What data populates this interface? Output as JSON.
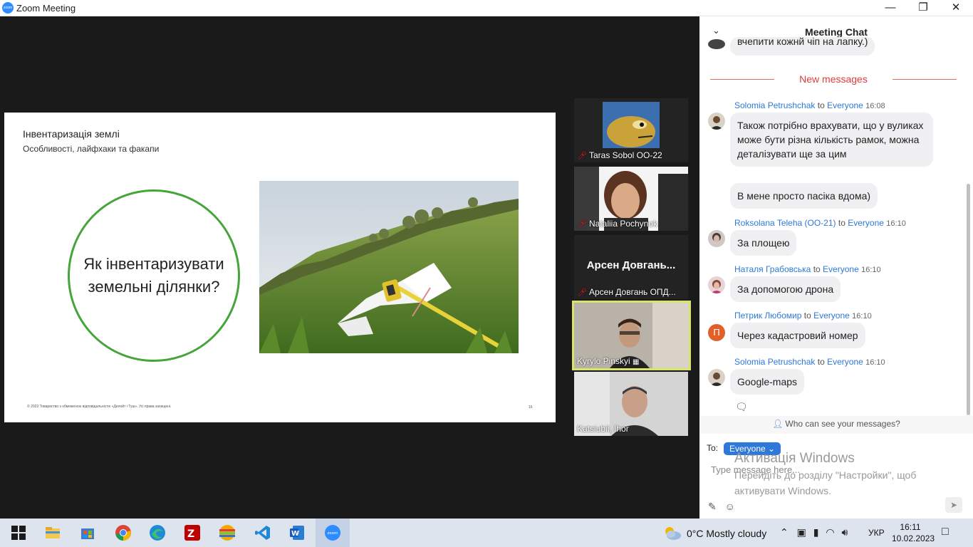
{
  "window": {
    "title": "Zoom Meeting",
    "app_icon_text": "zoom",
    "minimize": "—",
    "maximize": "❐",
    "close": "✕"
  },
  "slide": {
    "title": "Інвентаризація землі",
    "subtitle": "Особливості, лайфхаки та факапи",
    "circle_text": "Як інвентаризувати земельні ділянки?",
    "footer": "© 2023 Товариство з обмеженою відповідальністю «Делойт і Туш». Усі права захищені.",
    "page_number": "15"
  },
  "participants": [
    {
      "name": "Taras Sobol OO-22",
      "muted": true
    },
    {
      "name": "Nataliia Pochynok",
      "muted": true
    },
    {
      "big_name": "Арсен  Довгань...",
      "name": "Арсен Довгань ОПД...",
      "muted": true
    },
    {
      "name": "Kyrylo Pinskyi",
      "active": true
    },
    {
      "name": "Katsiubii, Ihor"
    }
  ],
  "chat": {
    "title": "Meeting Chat",
    "partial_message": "вчепити кожнй чіп на лапку.)",
    "new_messages_label": "New messages",
    "to_word": "to",
    "messages": [
      {
        "sender": "Solomia Petrushchak",
        "target": "Everyone",
        "time": "16:08",
        "bubbles": [
          "Також потрібно врахувати, що у вуликах може бути різна кількість рамок, можна деталізувати ще за цим",
          "В мене просто пасіка вдома)"
        ]
      },
      {
        "sender": "Roksolana Teleha (OO-21)",
        "target": "Everyone",
        "time": "16:10",
        "bubbles": [
          "За площею"
        ]
      },
      {
        "sender": "Наталя Грабовська",
        "target": "Everyone",
        "time": "16:10",
        "bubbles": [
          "За допомогою дрона"
        ]
      },
      {
        "sender": "Петрик Любомир",
        "target": "Everyone",
        "time": "16:10",
        "avatar_letter": "П",
        "bubbles": [
          "Через кадастровий номер"
        ]
      },
      {
        "sender": "Solomia Petrushchak",
        "target": "Everyone",
        "time": "16:10",
        "bubbles": [
          "Google-maps"
        ]
      }
    ],
    "who_can_see": "Who can see your messages?",
    "to_label": "To:",
    "recipient": "Everyone",
    "placeholder": "Type message here..."
  },
  "activation": {
    "title": "Активація Windows",
    "line1": "Перейдіть до розділу \"Настройки\", щоб",
    "line2": "активувати Windows."
  },
  "taskbar": {
    "weather": "0°C  Mostly cloudy",
    "language": "УКР",
    "time": "16:11",
    "date": "10.02.2023"
  },
  "colors": {
    "zoom_blue": "#2d8cff",
    "link_blue": "#2d78d8",
    "new_messages_red": "#e03c3c",
    "slide_green": "#45a43a",
    "active_speaker": "#d9e36b"
  }
}
